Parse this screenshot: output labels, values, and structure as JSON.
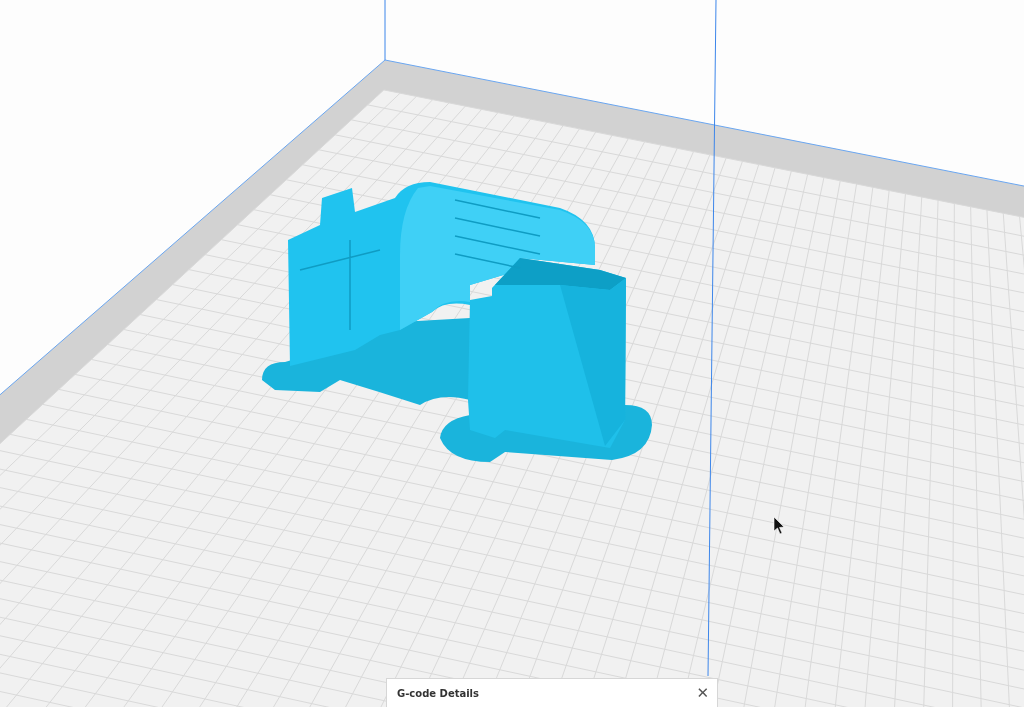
{
  "gcode_panel": {
    "title": "G-code Details",
    "close": "✕"
  }
}
